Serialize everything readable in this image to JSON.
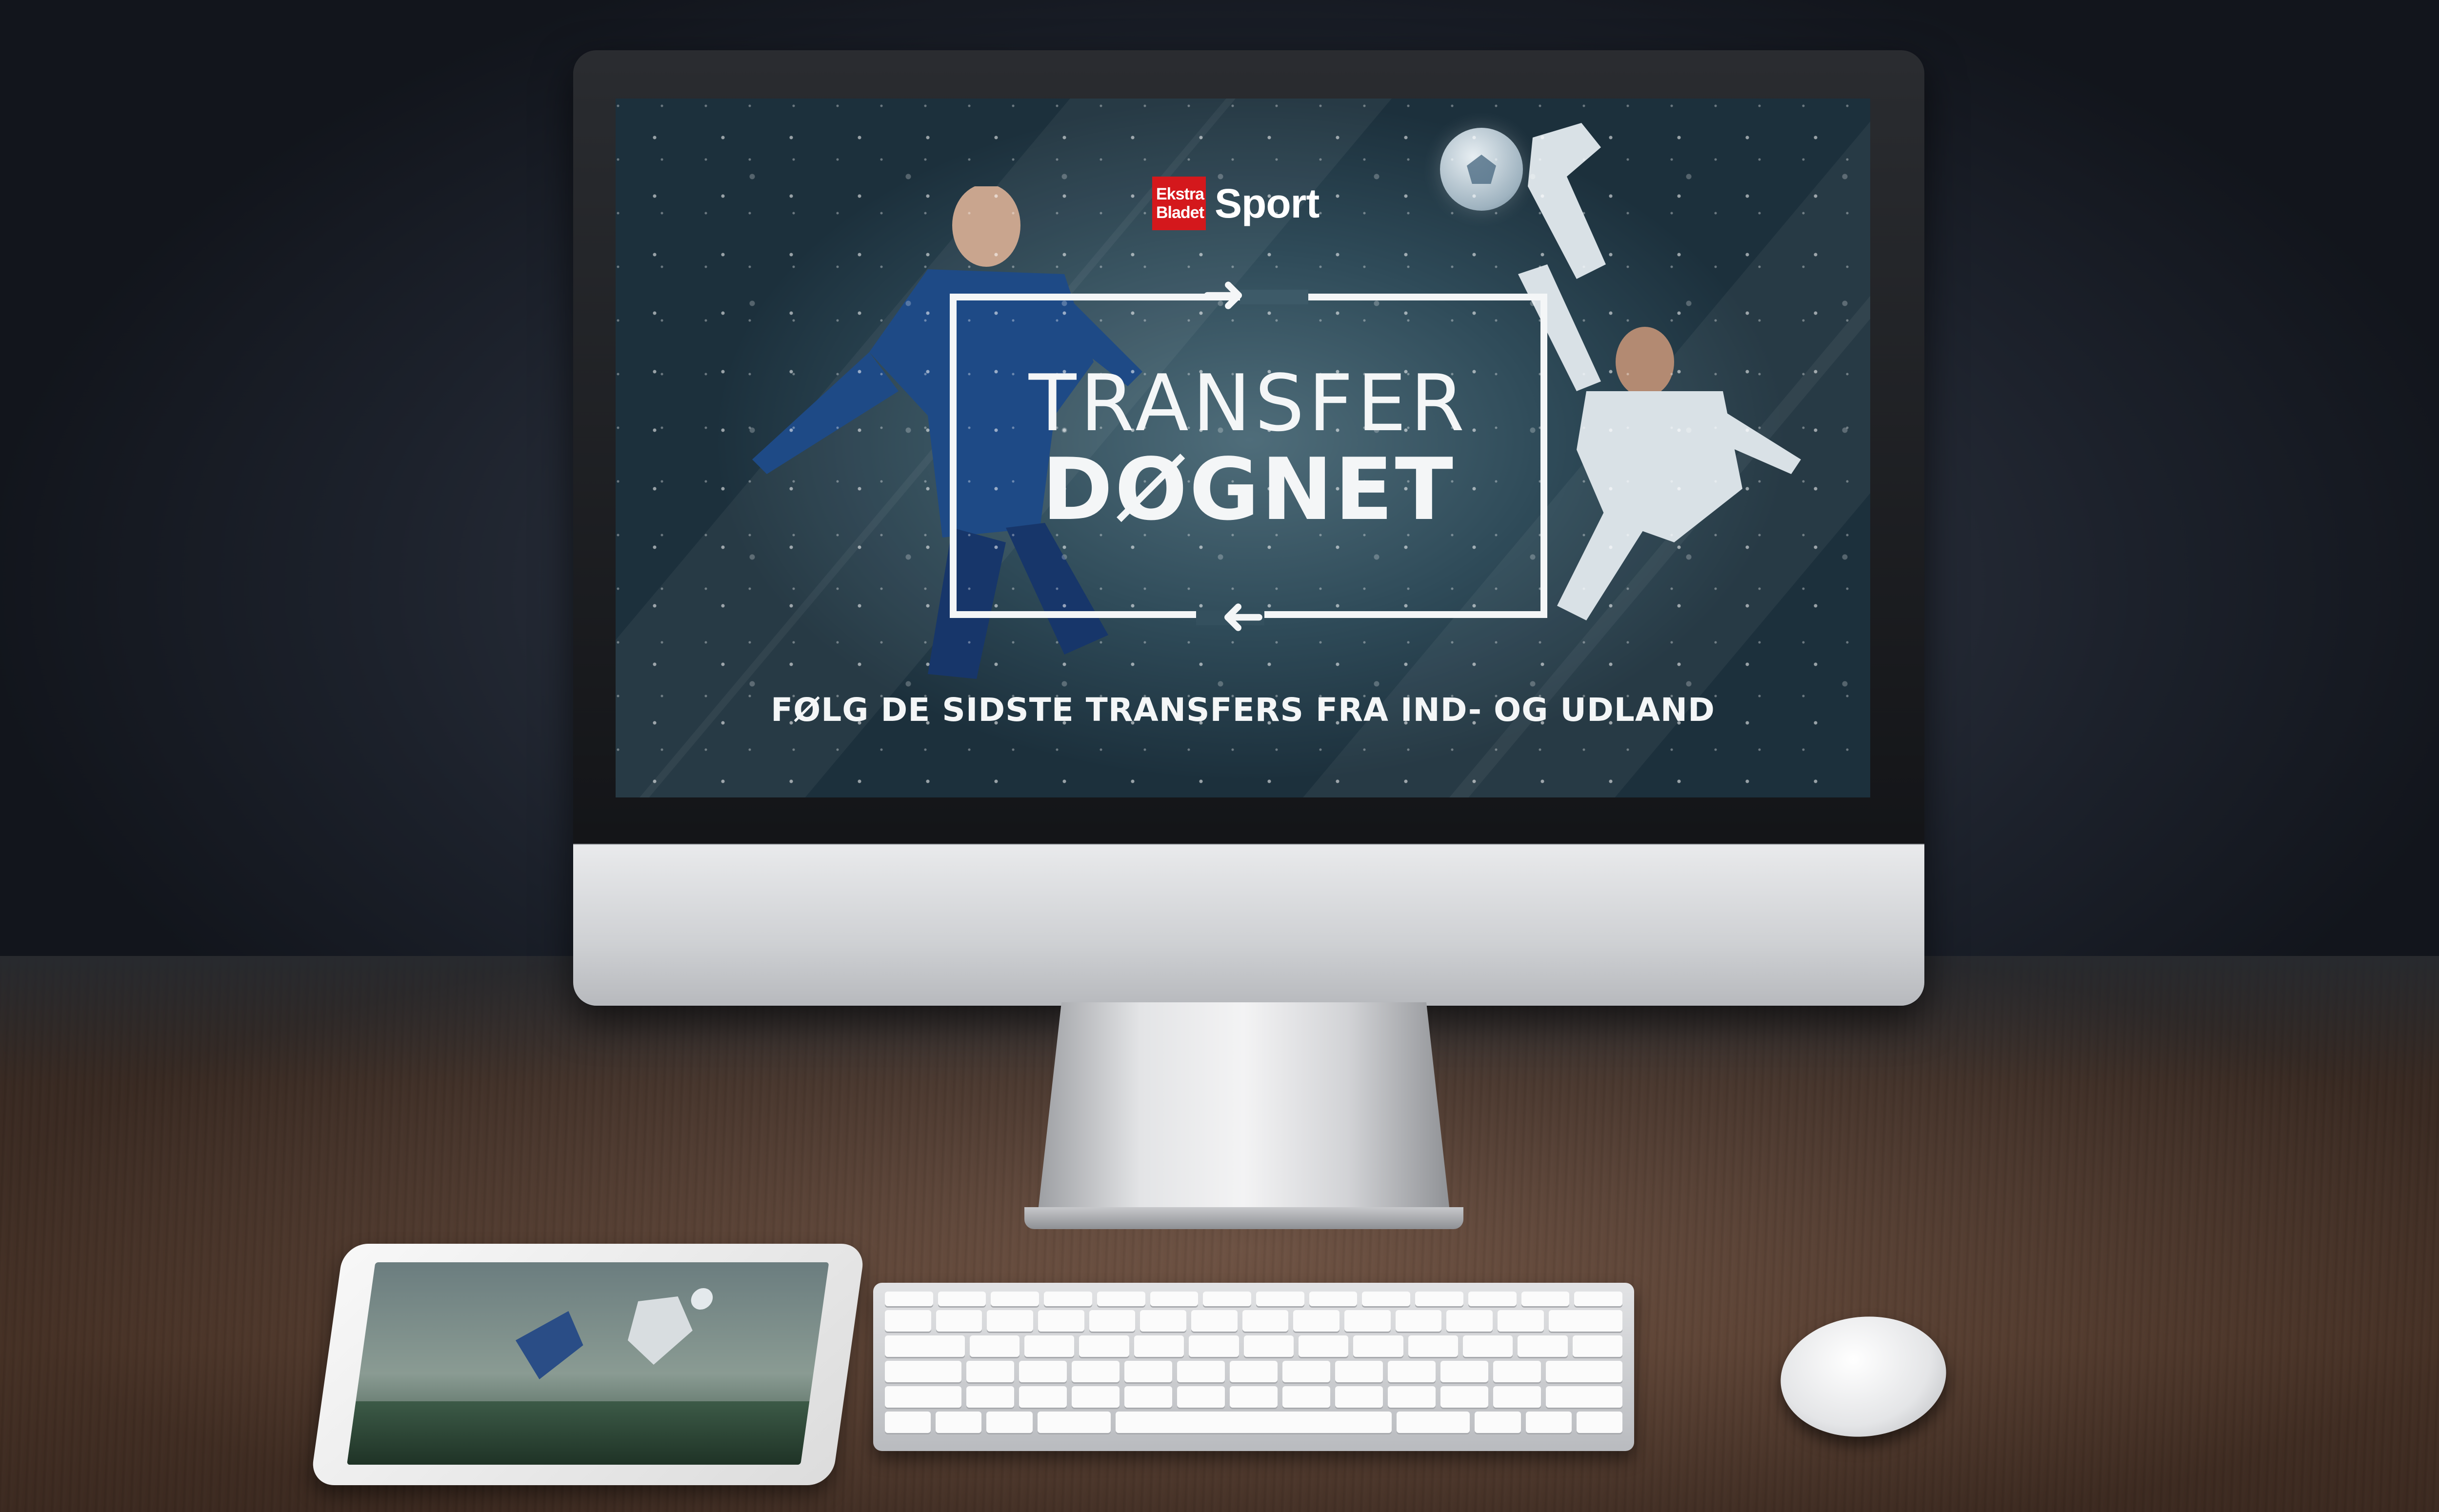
{
  "screen": {
    "brand": {
      "logo_line1": "Ekstra",
      "logo_line2": "Bladet",
      "section": "Sport",
      "logo_color": "#d4181c"
    },
    "title_line1": "TRANSFER",
    "title_line2": "DØGNET",
    "tagline": "FØLG DE SIDSTE TRANSFERS FRA IND- OG UDLAND",
    "frame_icons": [
      "arrow-right-icon",
      "arrow-left-icon"
    ]
  },
  "devices": [
    "monitor",
    "tablet",
    "keyboard",
    "mouse"
  ]
}
